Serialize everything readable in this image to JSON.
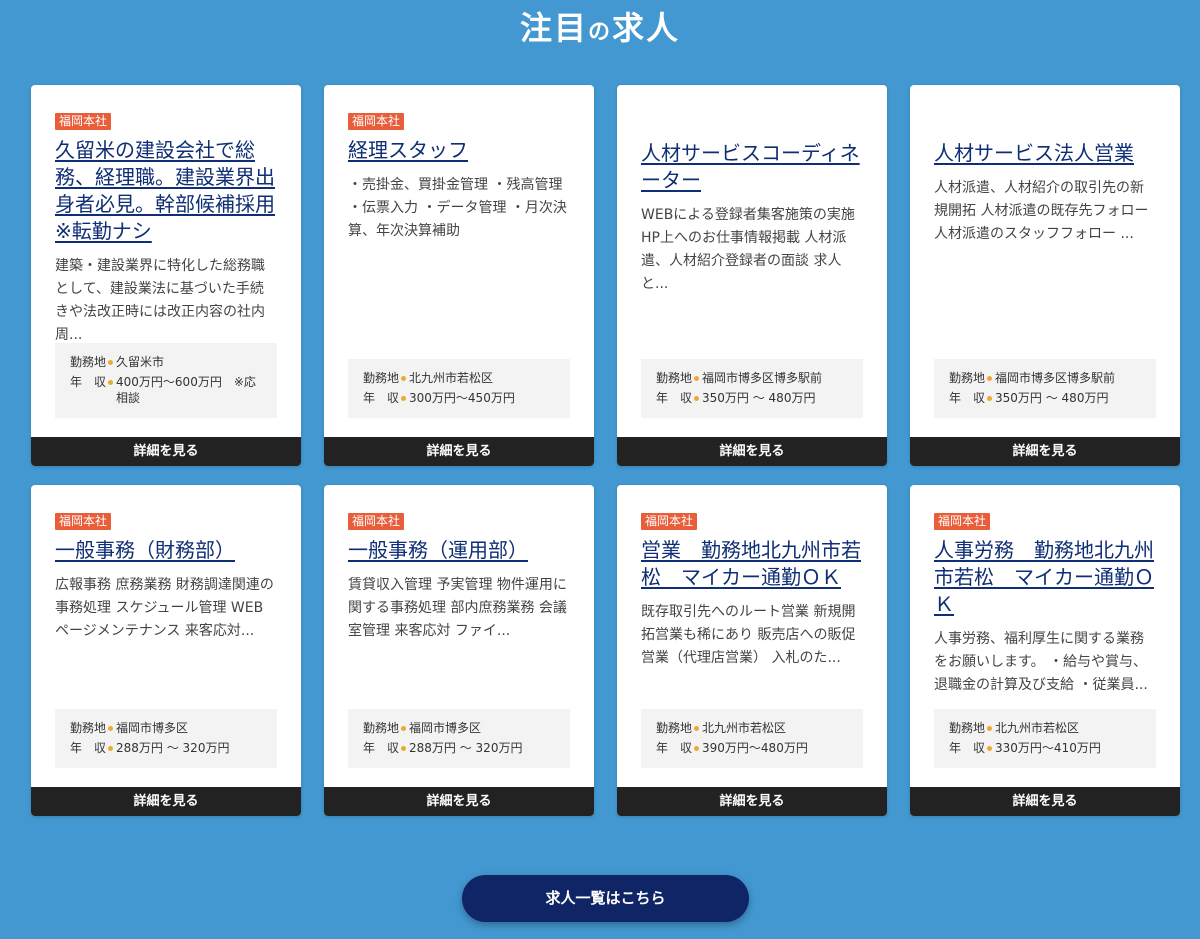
{
  "section": {
    "title_part1": "注目",
    "title_no": "の",
    "title_part2": "求人"
  },
  "cards": [
    {
      "badge": "福岡本社",
      "title": "久留米の建設会社で総務、経理職。建設業界出身者必見。幹部候補採用※転勤ナシ",
      "description": "建築・建設業界に特化した総務職として、建設業法に基づいた手続きや法改正時には改正内容の社内周...",
      "location_label": "勤務地",
      "location": "久留米市",
      "salary_label": "年　収",
      "salary": "400万円～600万円　※応相談",
      "button": "詳細を見る"
    },
    {
      "badge": "福岡本社",
      "title": "経理スタッフ",
      "description": "・売掛金、買掛金管理 ・残高管理 ・伝票入力 ・データ管理 ・月次決算、年次決算補助",
      "location_label": "勤務地",
      "location": "北九州市若松区",
      "salary_label": "年　収",
      "salary": "300万円～450万円",
      "button": "詳細を見る"
    },
    {
      "badge": "",
      "title": "人材サービスコーディネーター",
      "description": "WEBによる登録者集客施策の実施 HP上へのお仕事情報掲載 人材派遣、人材紹介登録者の面談 求人と...",
      "location_label": "勤務地",
      "location": "福岡市博多区博多駅前",
      "salary_label": "年　収",
      "salary": "350万円 ～ 480万円",
      "button": "詳細を見る"
    },
    {
      "badge": "",
      "title": "人材サービス法人営業",
      "description": "人材派遣、人材紹介の取引先の新規開拓 人材派遣の既存先フォロー 人材派遣のスタッフフォロー ...",
      "location_label": "勤務地",
      "location": "福岡市博多区博多駅前",
      "salary_label": "年　収",
      "salary": "350万円 ～ 480万円",
      "button": "詳細を見る"
    },
    {
      "badge": "福岡本社",
      "title": "一般事務（財務部）",
      "description": "広報事務 庶務業務 財務調達関連の事務処理 スケジュール管理 WEBページメンテナンス 来客応対...",
      "location_label": "勤務地",
      "location": "福岡市博多区",
      "salary_label": "年　収",
      "salary": "288万円 ～ 320万円",
      "button": "詳細を見る"
    },
    {
      "badge": "福岡本社",
      "title": "一般事務（運用部）",
      "description": "賃貸収入管理 予実管理 物件運用に関する事務処理 部内庶務業務 会議室管理 来客応対 ファイ...",
      "location_label": "勤務地",
      "location": "福岡市博多区",
      "salary_label": "年　収",
      "salary": "288万円 ～ 320万円",
      "button": "詳細を見る"
    },
    {
      "badge": "福岡本社",
      "title": "営業　勤務地北九州市若松　マイカー通勤ＯＫ",
      "description": "既存取引先へのルート営業 新規開拓営業も稀にあり 販売店への販促営業（代理店営業） 入札のた...",
      "location_label": "勤務地",
      "location": "北九州市若松区",
      "salary_label": "年　収",
      "salary": "390万円～480万円",
      "button": "詳細を見る"
    },
    {
      "badge": "福岡本社",
      "title": "人事労務　勤務地北九州市若松　マイカー通勤ＯＫ",
      "description": "人事労務、福利厚生に関する業務をお願いします。 ・給与や賞与、退職金の計算及び支給 ・従業員...",
      "location_label": "勤務地",
      "location": "北九州市若松区",
      "salary_label": "年　収",
      "salary": "330万円～410万円",
      "button": "詳細を見る"
    }
  ],
  "footer": {
    "list_button": "求人一覧はこちら"
  }
}
